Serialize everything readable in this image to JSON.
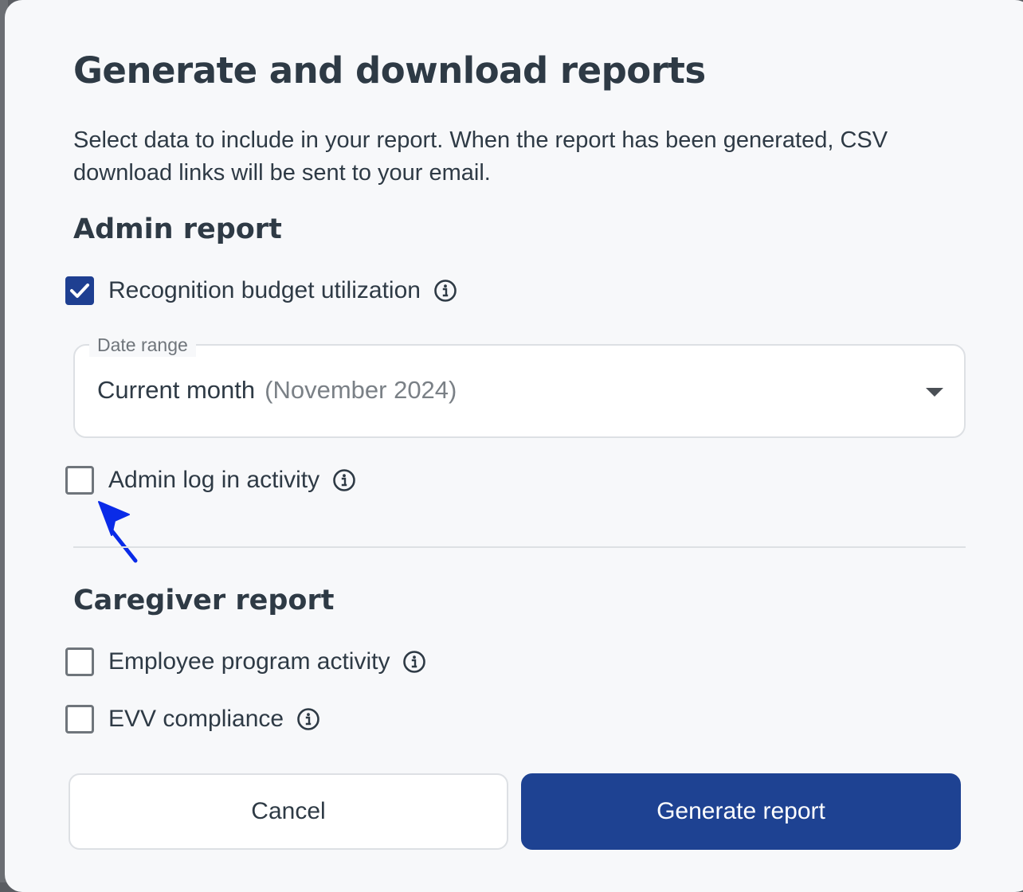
{
  "dialog": {
    "title": "Generate and download reports",
    "description": "Select data to include in your report. When the report has been generated, CSV download links will be sent to your email."
  },
  "admin_report": {
    "title": "Admin report",
    "budget_utilization": {
      "label": "Recognition budget utilization",
      "checked": true
    },
    "date_range": {
      "legend": "Date range",
      "value": "Current month",
      "hint": "(November 2024)"
    },
    "login_activity": {
      "label": "Admin log in activity",
      "checked": false
    }
  },
  "caregiver_report": {
    "title": "Caregiver report",
    "program_activity": {
      "label": "Employee program activity",
      "checked": false
    },
    "evv_compliance": {
      "label": "EVV compliance",
      "checked": false
    }
  },
  "actions": {
    "cancel_label": "Cancel",
    "generate_label": "Generate report"
  },
  "colors": {
    "primary": "#1e4292",
    "text": "#2e3a45",
    "annotation_arrow": "#0a2be8"
  },
  "icons": {
    "info": "info-circle-icon",
    "check": "checkmark-icon",
    "dropdown": "caret-down-icon",
    "annotation": "arrow-annotation-icon"
  }
}
